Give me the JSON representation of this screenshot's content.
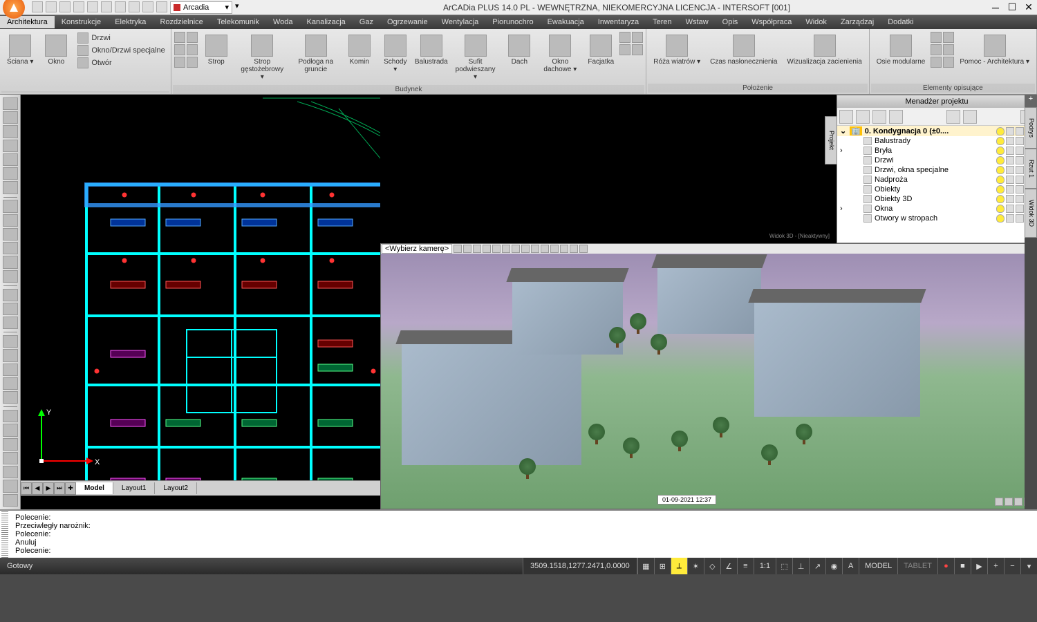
{
  "window": {
    "title": "ArCADia PLUS 14.0 PL - WEWNĘTRZNA, NIEKOMERCYJNA LICENCJA - INTERSOFT [001]",
    "layer_combo": "Arcadia"
  },
  "menu_tabs": [
    "Architektura",
    "Konstrukcje",
    "Elektryka",
    "Rozdzielnice",
    "Telekomunik",
    "Woda",
    "Kanalizacja",
    "Gaz",
    "Ogrzewanie",
    "Wentylacja",
    "Piorunochro",
    "Ewakuacja",
    "Inwentaryza",
    "Teren",
    "Wstaw",
    "Opis",
    "Współpraca",
    "Widok",
    "Zarządzaj",
    "Dodatki"
  ],
  "active_tab": "Architektura",
  "ribbon": {
    "groups": [
      {
        "label": "",
        "items_lg": [
          {
            "t": "Ściana ▾"
          },
          {
            "t": "Okno"
          }
        ],
        "rows": [
          {
            "t": "Drzwi"
          },
          {
            "t": "Okno/Drzwi specjalne"
          },
          {
            "t": "Otwór"
          }
        ]
      },
      {
        "label": "Budynek",
        "grid": true,
        "items_lg": [
          {
            "t": "Strop"
          },
          {
            "t": "Strop gęstożebrowy ▾"
          },
          {
            "t": "Podłoga na gruncie"
          },
          {
            "t": "Komin"
          },
          {
            "t": "Schody ▾"
          },
          {
            "t": "Balustrada"
          },
          {
            "t": "Sufit podwieszany ▾"
          },
          {
            "t": "Dach"
          },
          {
            "t": "Okno dachowe ▾"
          },
          {
            "t": "Facjatka"
          }
        ]
      },
      {
        "label": "Położenie",
        "items_lg": [
          {
            "t": "Róża wiatrów ▾"
          },
          {
            "t": "Czas nasłonecznienia"
          },
          {
            "t": "Wizualizacja zacienienia"
          }
        ]
      },
      {
        "label": "Elementy opisujące",
        "items_lg": [
          {
            "t": "Osie modularne"
          },
          {
            "t": "Pomoc - Architektura ▾"
          }
        ],
        "grid2": true
      }
    ]
  },
  "layout_tabs": {
    "items": [
      "Model",
      "Layout1",
      "Layout2"
    ],
    "active": "Model"
  },
  "project_manager": {
    "title": "Menadżer projektu",
    "side_tab": "Projekt",
    "right_tabs": [
      "Podrys",
      "Rzut 1",
      "Widok 3D"
    ],
    "root": "0. Kondygnacja 0 (±0....",
    "items": [
      {
        "name": "Balustrady",
        "c": "#ffffff"
      },
      {
        "name": "Bryła",
        "c": "#ffffff",
        "exp": true
      },
      {
        "name": "Drzwi",
        "c": "#b5651d"
      },
      {
        "name": "Drzwi, okna specjalne",
        "c": "#ffffff"
      },
      {
        "name": "Nadproża",
        "c": "#ffffff"
      },
      {
        "name": "Obiekty",
        "c": "#a8d8ff"
      },
      {
        "name": "Obiekty 3D",
        "c": "#ffffff"
      },
      {
        "name": "Okna",
        "c": "#ffffff",
        "exp": true
      },
      {
        "name": "Otwory w stropach",
        "c": "#ffffff"
      }
    ]
  },
  "command_line": {
    "lines": [
      "Polecenie:",
      "Przeciwległy narożnik:",
      "Polecenie:",
      "Anuluj",
      "Polecenie:"
    ]
  },
  "statusbar": {
    "ready": "Gotowy",
    "coords": "3509.1518,1277.2471,0.0000",
    "scale": "1:1",
    "model": "MODEL",
    "tablet": "TABLET"
  },
  "view3d": {
    "label_inactive": "Widok 3D - [Nieaktywny]",
    "camera_sel": "<Wybierz kamerę>",
    "timestamp": "01-09-2021 12:37"
  },
  "ucs": {
    "x": "X",
    "y": "Y"
  }
}
